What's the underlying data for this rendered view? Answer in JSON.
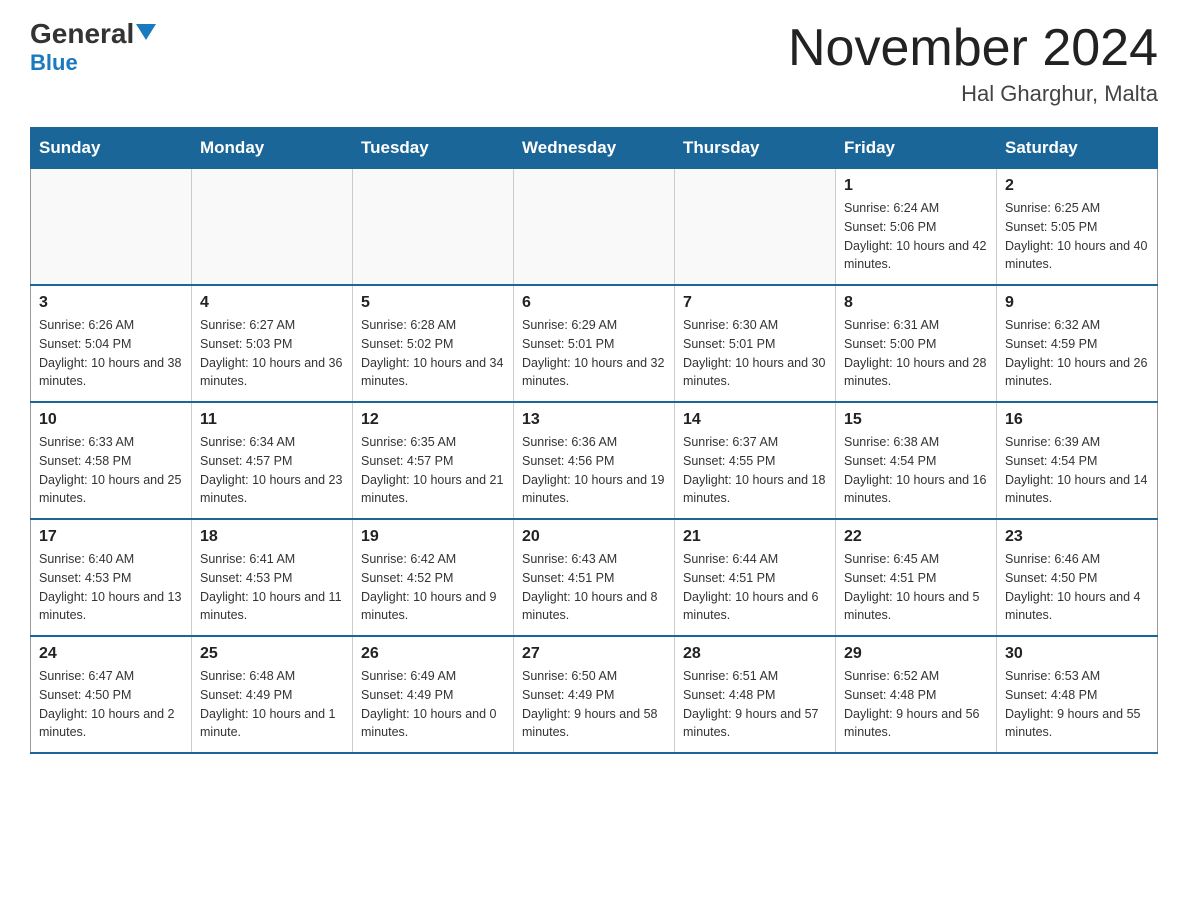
{
  "header": {
    "logo_text_general": "General",
    "logo_text_blue": "Blue",
    "month_year": "November 2024",
    "location": "Hal Gharghur, Malta"
  },
  "calendar": {
    "days_of_week": [
      "Sunday",
      "Monday",
      "Tuesday",
      "Wednesday",
      "Thursday",
      "Friday",
      "Saturday"
    ],
    "weeks": [
      [
        {
          "day": "",
          "info": ""
        },
        {
          "day": "",
          "info": ""
        },
        {
          "day": "",
          "info": ""
        },
        {
          "day": "",
          "info": ""
        },
        {
          "day": "",
          "info": ""
        },
        {
          "day": "1",
          "info": "Sunrise: 6:24 AM\nSunset: 5:06 PM\nDaylight: 10 hours and 42 minutes."
        },
        {
          "day": "2",
          "info": "Sunrise: 6:25 AM\nSunset: 5:05 PM\nDaylight: 10 hours and 40 minutes."
        }
      ],
      [
        {
          "day": "3",
          "info": "Sunrise: 6:26 AM\nSunset: 5:04 PM\nDaylight: 10 hours and 38 minutes."
        },
        {
          "day": "4",
          "info": "Sunrise: 6:27 AM\nSunset: 5:03 PM\nDaylight: 10 hours and 36 minutes."
        },
        {
          "day": "5",
          "info": "Sunrise: 6:28 AM\nSunset: 5:02 PM\nDaylight: 10 hours and 34 minutes."
        },
        {
          "day": "6",
          "info": "Sunrise: 6:29 AM\nSunset: 5:01 PM\nDaylight: 10 hours and 32 minutes."
        },
        {
          "day": "7",
          "info": "Sunrise: 6:30 AM\nSunset: 5:01 PM\nDaylight: 10 hours and 30 minutes."
        },
        {
          "day": "8",
          "info": "Sunrise: 6:31 AM\nSunset: 5:00 PM\nDaylight: 10 hours and 28 minutes."
        },
        {
          "day": "9",
          "info": "Sunrise: 6:32 AM\nSunset: 4:59 PM\nDaylight: 10 hours and 26 minutes."
        }
      ],
      [
        {
          "day": "10",
          "info": "Sunrise: 6:33 AM\nSunset: 4:58 PM\nDaylight: 10 hours and 25 minutes."
        },
        {
          "day": "11",
          "info": "Sunrise: 6:34 AM\nSunset: 4:57 PM\nDaylight: 10 hours and 23 minutes."
        },
        {
          "day": "12",
          "info": "Sunrise: 6:35 AM\nSunset: 4:57 PM\nDaylight: 10 hours and 21 minutes."
        },
        {
          "day": "13",
          "info": "Sunrise: 6:36 AM\nSunset: 4:56 PM\nDaylight: 10 hours and 19 minutes."
        },
        {
          "day": "14",
          "info": "Sunrise: 6:37 AM\nSunset: 4:55 PM\nDaylight: 10 hours and 18 minutes."
        },
        {
          "day": "15",
          "info": "Sunrise: 6:38 AM\nSunset: 4:54 PM\nDaylight: 10 hours and 16 minutes."
        },
        {
          "day": "16",
          "info": "Sunrise: 6:39 AM\nSunset: 4:54 PM\nDaylight: 10 hours and 14 minutes."
        }
      ],
      [
        {
          "day": "17",
          "info": "Sunrise: 6:40 AM\nSunset: 4:53 PM\nDaylight: 10 hours and 13 minutes."
        },
        {
          "day": "18",
          "info": "Sunrise: 6:41 AM\nSunset: 4:53 PM\nDaylight: 10 hours and 11 minutes."
        },
        {
          "day": "19",
          "info": "Sunrise: 6:42 AM\nSunset: 4:52 PM\nDaylight: 10 hours and 9 minutes."
        },
        {
          "day": "20",
          "info": "Sunrise: 6:43 AM\nSunset: 4:51 PM\nDaylight: 10 hours and 8 minutes."
        },
        {
          "day": "21",
          "info": "Sunrise: 6:44 AM\nSunset: 4:51 PM\nDaylight: 10 hours and 6 minutes."
        },
        {
          "day": "22",
          "info": "Sunrise: 6:45 AM\nSunset: 4:51 PM\nDaylight: 10 hours and 5 minutes."
        },
        {
          "day": "23",
          "info": "Sunrise: 6:46 AM\nSunset: 4:50 PM\nDaylight: 10 hours and 4 minutes."
        }
      ],
      [
        {
          "day": "24",
          "info": "Sunrise: 6:47 AM\nSunset: 4:50 PM\nDaylight: 10 hours and 2 minutes."
        },
        {
          "day": "25",
          "info": "Sunrise: 6:48 AM\nSunset: 4:49 PM\nDaylight: 10 hours and 1 minute."
        },
        {
          "day": "26",
          "info": "Sunrise: 6:49 AM\nSunset: 4:49 PM\nDaylight: 10 hours and 0 minutes."
        },
        {
          "day": "27",
          "info": "Sunrise: 6:50 AM\nSunset: 4:49 PM\nDaylight: 9 hours and 58 minutes."
        },
        {
          "day": "28",
          "info": "Sunrise: 6:51 AM\nSunset: 4:48 PM\nDaylight: 9 hours and 57 minutes."
        },
        {
          "day": "29",
          "info": "Sunrise: 6:52 AM\nSunset: 4:48 PM\nDaylight: 9 hours and 56 minutes."
        },
        {
          "day": "30",
          "info": "Sunrise: 6:53 AM\nSunset: 4:48 PM\nDaylight: 9 hours and 55 minutes."
        }
      ]
    ]
  }
}
